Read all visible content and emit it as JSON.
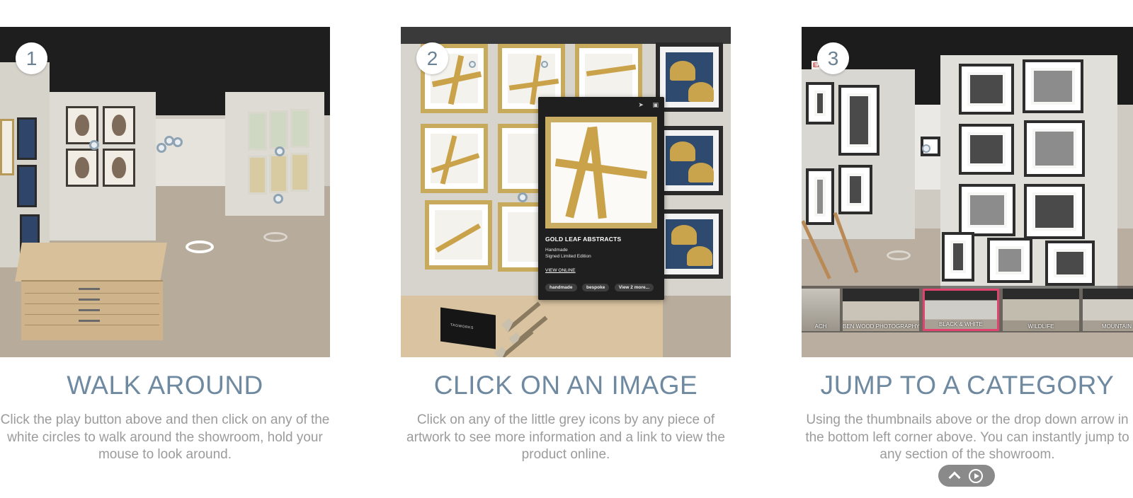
{
  "steps": [
    {
      "number": "1",
      "title": "WALK AROUND",
      "description": "Click the play button above and then click on any of the white circles to walk around the showroom, hold your mouse to look around."
    },
    {
      "number": "2",
      "title": "CLICK ON AN IMAGE",
      "description": "Click on any of the little grey icons by any piece of artwork to see more information and a link to view the product online."
    },
    {
      "number": "3",
      "title": "JUMP TO A CATEGORY",
      "description": "Using the thumbnails above or the drop down arrow in the bottom left corner above. You can instantly jump to any section of the showroom."
    }
  ],
  "popup": {
    "title": "GOLD LEAF ABSTRACTS",
    "line1": "Handmade",
    "line2": "Signed Limited Edition",
    "link_label": "VIEW ONLINE",
    "tags": [
      "handmade",
      "bespoke",
      "View 2 more..."
    ],
    "icons": [
      "share-icon",
      "expand-icon"
    ]
  },
  "box_brand": "TAGWORKS",
  "exit_sign": "EXIT",
  "category_thumbnails": [
    "ACH",
    "BEN WOOD PHOTOGRAPHY",
    "BLACK & WHITE",
    "WILDLIFE",
    "MOUNTAIN"
  ],
  "active_category": "BLACK & WHITE",
  "bottom_controls": {
    "icons": [
      "chevron-up-icon",
      "play-circle-icon"
    ]
  },
  "colors": {
    "title": "#6f8aa0",
    "description": "#9b9b9b",
    "active_thumb_border": "#e0436d",
    "popup_bg": "#1f1f1f"
  }
}
